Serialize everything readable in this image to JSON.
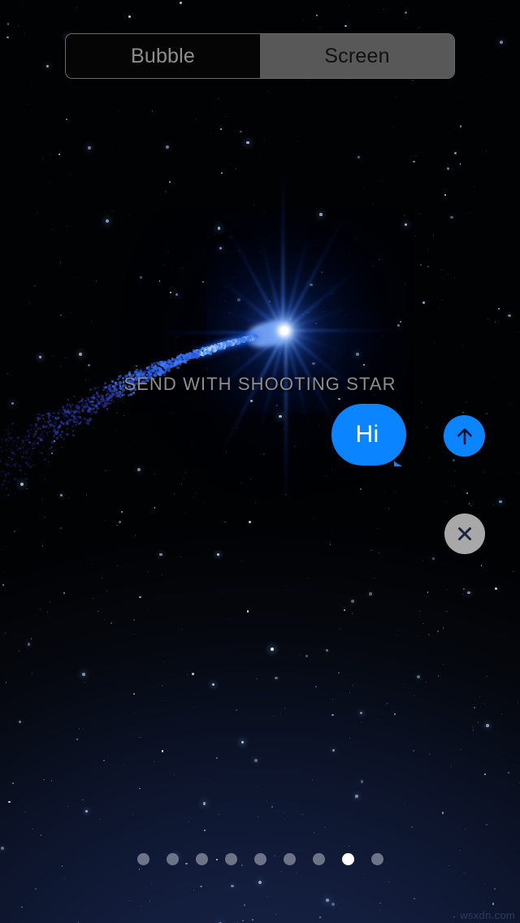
{
  "segmented_control": {
    "options": [
      {
        "label": "Bubble",
        "active": false
      },
      {
        "label": "Screen",
        "active": true
      }
    ]
  },
  "effect": {
    "caption": "SEND WITH SHOOTING STAR",
    "name": "shooting-star"
  },
  "message": {
    "bubble_text": "Hi",
    "bubble_color": "#0b84ff",
    "send_button_color": "#0b84ff",
    "send_icon": "arrow-up-icon",
    "close_button_color": "#a8a8a8",
    "close_icon": "close-x-icon"
  },
  "page_dots": {
    "count": 9,
    "active_index": 7,
    "active_color": "#ffffff",
    "inactive_color": "#6e7488"
  },
  "watermark": {
    "text": "wsxdn.com"
  },
  "theme": {
    "background_top": "#000000",
    "background_bottom": "#121d3c",
    "caption_color": "#8d8d8d",
    "segment_active_bg": "#585858",
    "segment_inactive_text": "#8e8e8e",
    "star_core_color": "#ffffff",
    "star_glow_color": "#1c50dc"
  }
}
